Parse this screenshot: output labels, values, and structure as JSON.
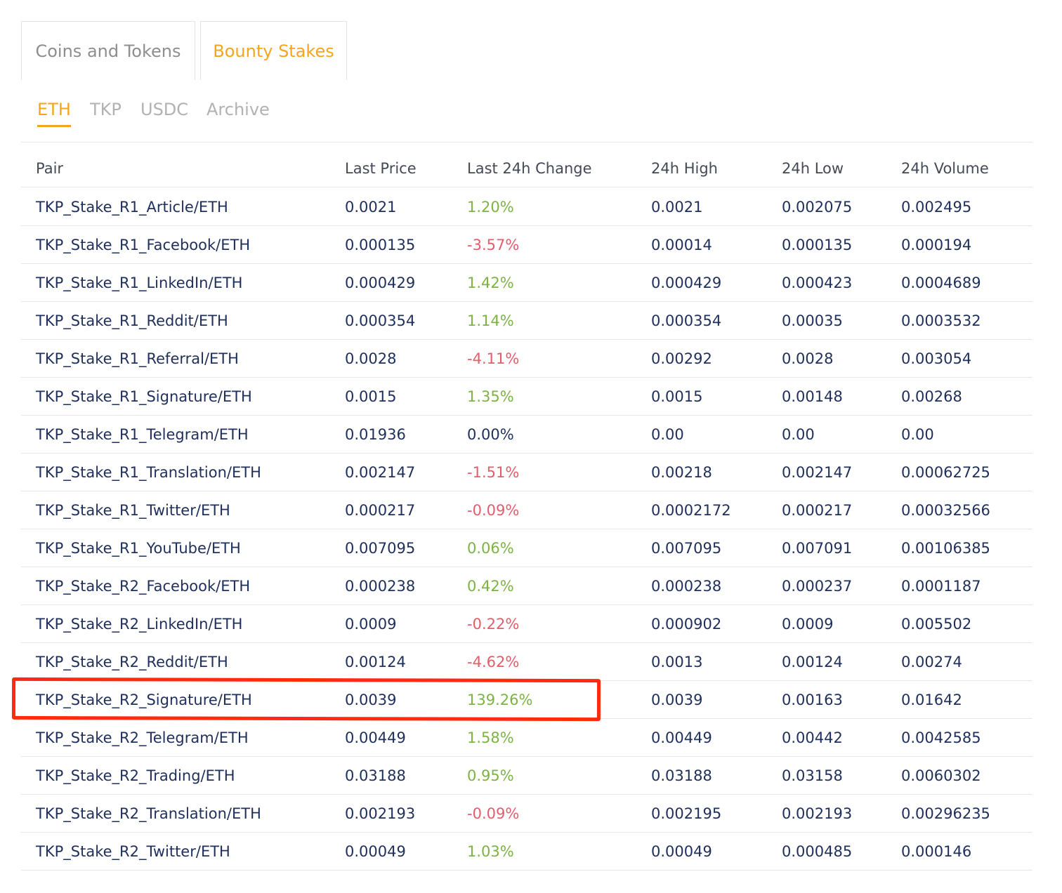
{
  "main_tabs": [
    {
      "label": "Coins and Tokens",
      "active": false
    },
    {
      "label": "Bounty Stakes",
      "active": true
    }
  ],
  "sub_tabs": [
    {
      "label": "ETH",
      "active": true
    },
    {
      "label": "TKP",
      "active": false
    },
    {
      "label": "USDC",
      "active": false
    },
    {
      "label": "Archive",
      "active": false
    }
  ],
  "colors": {
    "accent": "#f5a51d",
    "positive": "#7cb342",
    "negative": "#e35d6a",
    "text": "#1f2f5c",
    "annotation": "#ff2a0f"
  },
  "table": {
    "headers": [
      "Pair",
      "Last Price",
      "Last 24h Change",
      "24h High",
      "24h Low",
      "24h Volume"
    ],
    "rows": [
      {
        "pair": "TKP_Stake_R1_Article/ETH",
        "last_price": "0.0021",
        "change": "1.20%",
        "direction": "up",
        "high": "0.0021",
        "low": "0.002075",
        "volume": "0.002495"
      },
      {
        "pair": "TKP_Stake_R1_Facebook/ETH",
        "last_price": "0.000135",
        "change": "-3.57%",
        "direction": "down",
        "high": "0.00014",
        "low": "0.000135",
        "volume": "0.000194"
      },
      {
        "pair": "TKP_Stake_R1_LinkedIn/ETH",
        "last_price": "0.000429",
        "change": "1.42%",
        "direction": "up",
        "high": "0.000429",
        "low": "0.000423",
        "volume": "0.0004689"
      },
      {
        "pair": "TKP_Stake_R1_Reddit/ETH",
        "last_price": "0.000354",
        "change": "1.14%",
        "direction": "up",
        "high": "0.000354",
        "low": "0.00035",
        "volume": "0.0003532"
      },
      {
        "pair": "TKP_Stake_R1_Referral/ETH",
        "last_price": "0.0028",
        "change": "-4.11%",
        "direction": "down",
        "high": "0.00292",
        "low": "0.0028",
        "volume": "0.003054"
      },
      {
        "pair": "TKP_Stake_R1_Signature/ETH",
        "last_price": "0.0015",
        "change": "1.35%",
        "direction": "up",
        "high": "0.0015",
        "low": "0.00148",
        "volume": "0.00268"
      },
      {
        "pair": "TKP_Stake_R1_Telegram/ETH",
        "last_price": "0.01936",
        "change": "0.00%",
        "direction": "flat",
        "high": "0.00",
        "low": "0.00",
        "volume": "0.00"
      },
      {
        "pair": "TKP_Stake_R1_Translation/ETH",
        "last_price": "0.002147",
        "change": "-1.51%",
        "direction": "down",
        "high": "0.00218",
        "low": "0.002147",
        "volume": "0.00062725"
      },
      {
        "pair": "TKP_Stake_R1_Twitter/ETH",
        "last_price": "0.000217",
        "change": "-0.09%",
        "direction": "down",
        "high": "0.0002172",
        "low": "0.000217",
        "volume": "0.00032566"
      },
      {
        "pair": "TKP_Stake_R1_YouTube/ETH",
        "last_price": "0.007095",
        "change": "0.06%",
        "direction": "up",
        "high": "0.007095",
        "low": "0.007091",
        "volume": "0.00106385"
      },
      {
        "pair": "TKP_Stake_R2_Facebook/ETH",
        "last_price": "0.000238",
        "change": "0.42%",
        "direction": "up",
        "high": "0.000238",
        "low": "0.000237",
        "volume": "0.0001187"
      },
      {
        "pair": "TKP_Stake_R2_LinkedIn/ETH",
        "last_price": "0.0009",
        "change": "-0.22%",
        "direction": "down",
        "high": "0.000902",
        "low": "0.0009",
        "volume": "0.005502"
      },
      {
        "pair": "TKP_Stake_R2_Reddit/ETH",
        "last_price": "0.00124",
        "change": "-4.62%",
        "direction": "down",
        "high": "0.0013",
        "low": "0.00124",
        "volume": "0.00274"
      },
      {
        "pair": "TKP_Stake_R2_Signature/ETH",
        "last_price": "0.0039",
        "change": "139.26%",
        "direction": "up",
        "high": "0.0039",
        "low": "0.00163",
        "volume": "0.01642",
        "highlighted": true
      },
      {
        "pair": "TKP_Stake_R2_Telegram/ETH",
        "last_price": "0.00449",
        "change": "1.58%",
        "direction": "up",
        "high": "0.00449",
        "low": "0.00442",
        "volume": "0.0042585"
      },
      {
        "pair": "TKP_Stake_R2_Trading/ETH",
        "last_price": "0.03188",
        "change": "0.95%",
        "direction": "up",
        "high": "0.03188",
        "low": "0.03158",
        "volume": "0.0060302"
      },
      {
        "pair": "TKP_Stake_R2_Translation/ETH",
        "last_price": "0.002193",
        "change": "-0.09%",
        "direction": "down",
        "high": "0.002195",
        "low": "0.002193",
        "volume": "0.00296235"
      },
      {
        "pair": "TKP_Stake_R2_Twitter/ETH",
        "last_price": "0.00049",
        "change": "1.03%",
        "direction": "up",
        "high": "0.00049",
        "low": "0.000485",
        "volume": "0.000146"
      }
    ]
  }
}
